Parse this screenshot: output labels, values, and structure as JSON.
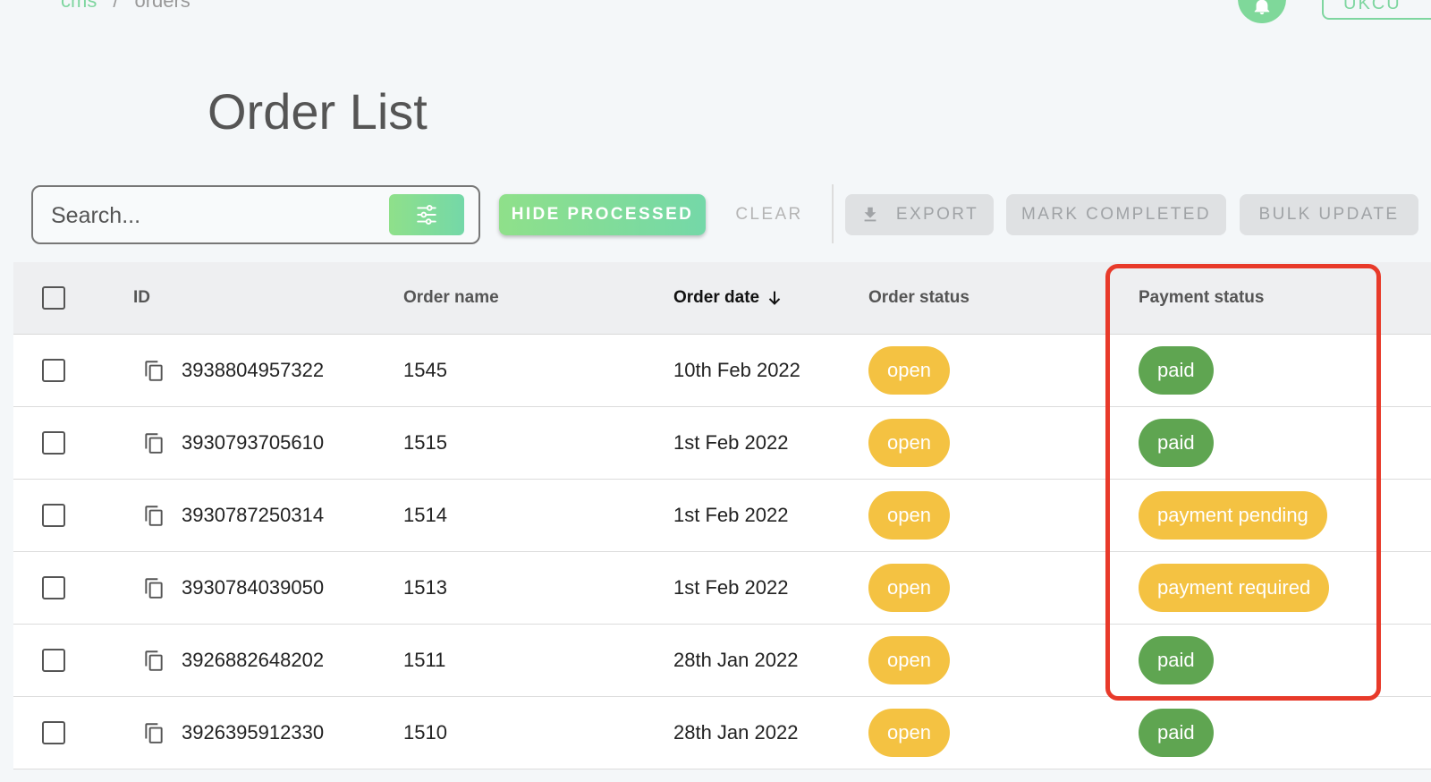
{
  "breadcrumb": {
    "parent": "cms",
    "separator": "/",
    "current": "orders"
  },
  "header": {
    "top_button_label": "UKCU"
  },
  "page": {
    "title": "Order List"
  },
  "toolbar": {
    "search_placeholder": "Search...",
    "hide_processed_label": "HIDE PROCESSED",
    "clear_label": "CLEAR",
    "export_label": "EXPORT",
    "mark_completed_label": "MARK COMPLETED",
    "bulk_update_label": "BULK UPDATE"
  },
  "table": {
    "headers": {
      "id": "ID",
      "order_name": "Order name",
      "order_date": "Order date",
      "order_status": "Order status",
      "payment_status": "Payment status"
    },
    "rows": [
      {
        "id": "3938804957322",
        "order_name": "1545",
        "order_date": "10th Feb 2022",
        "order_status": "open",
        "payment_status": "paid"
      },
      {
        "id": "3930793705610",
        "order_name": "1515",
        "order_date": "1st Feb 2022",
        "order_status": "open",
        "payment_status": "paid"
      },
      {
        "id": "3930787250314",
        "order_name": "1514",
        "order_date": "1st Feb 2022",
        "order_status": "open",
        "payment_status": "payment pending"
      },
      {
        "id": "3930784039050",
        "order_name": "1513",
        "order_date": "1st Feb 2022",
        "order_status": "open",
        "payment_status": "payment required"
      },
      {
        "id": "3926882648202",
        "order_name": "1511",
        "order_date": "28th Jan 2022",
        "order_status": "open",
        "payment_status": "paid"
      },
      {
        "id": "3926395912330",
        "order_name": "1510",
        "order_date": "28th Jan 2022",
        "order_status": "open",
        "payment_status": "paid"
      }
    ]
  },
  "colors": {
    "accent_green": "#7fd6a0",
    "status_open": "#f4c242",
    "status_paid": "#5fa551",
    "status_pending": "#f4c242",
    "highlight": "#e83a2a"
  },
  "icons": {
    "bell": "bell-icon",
    "filter": "sliders-icon",
    "export": "download-icon",
    "copy": "copy-icon",
    "sort": "arrow-down-icon"
  }
}
